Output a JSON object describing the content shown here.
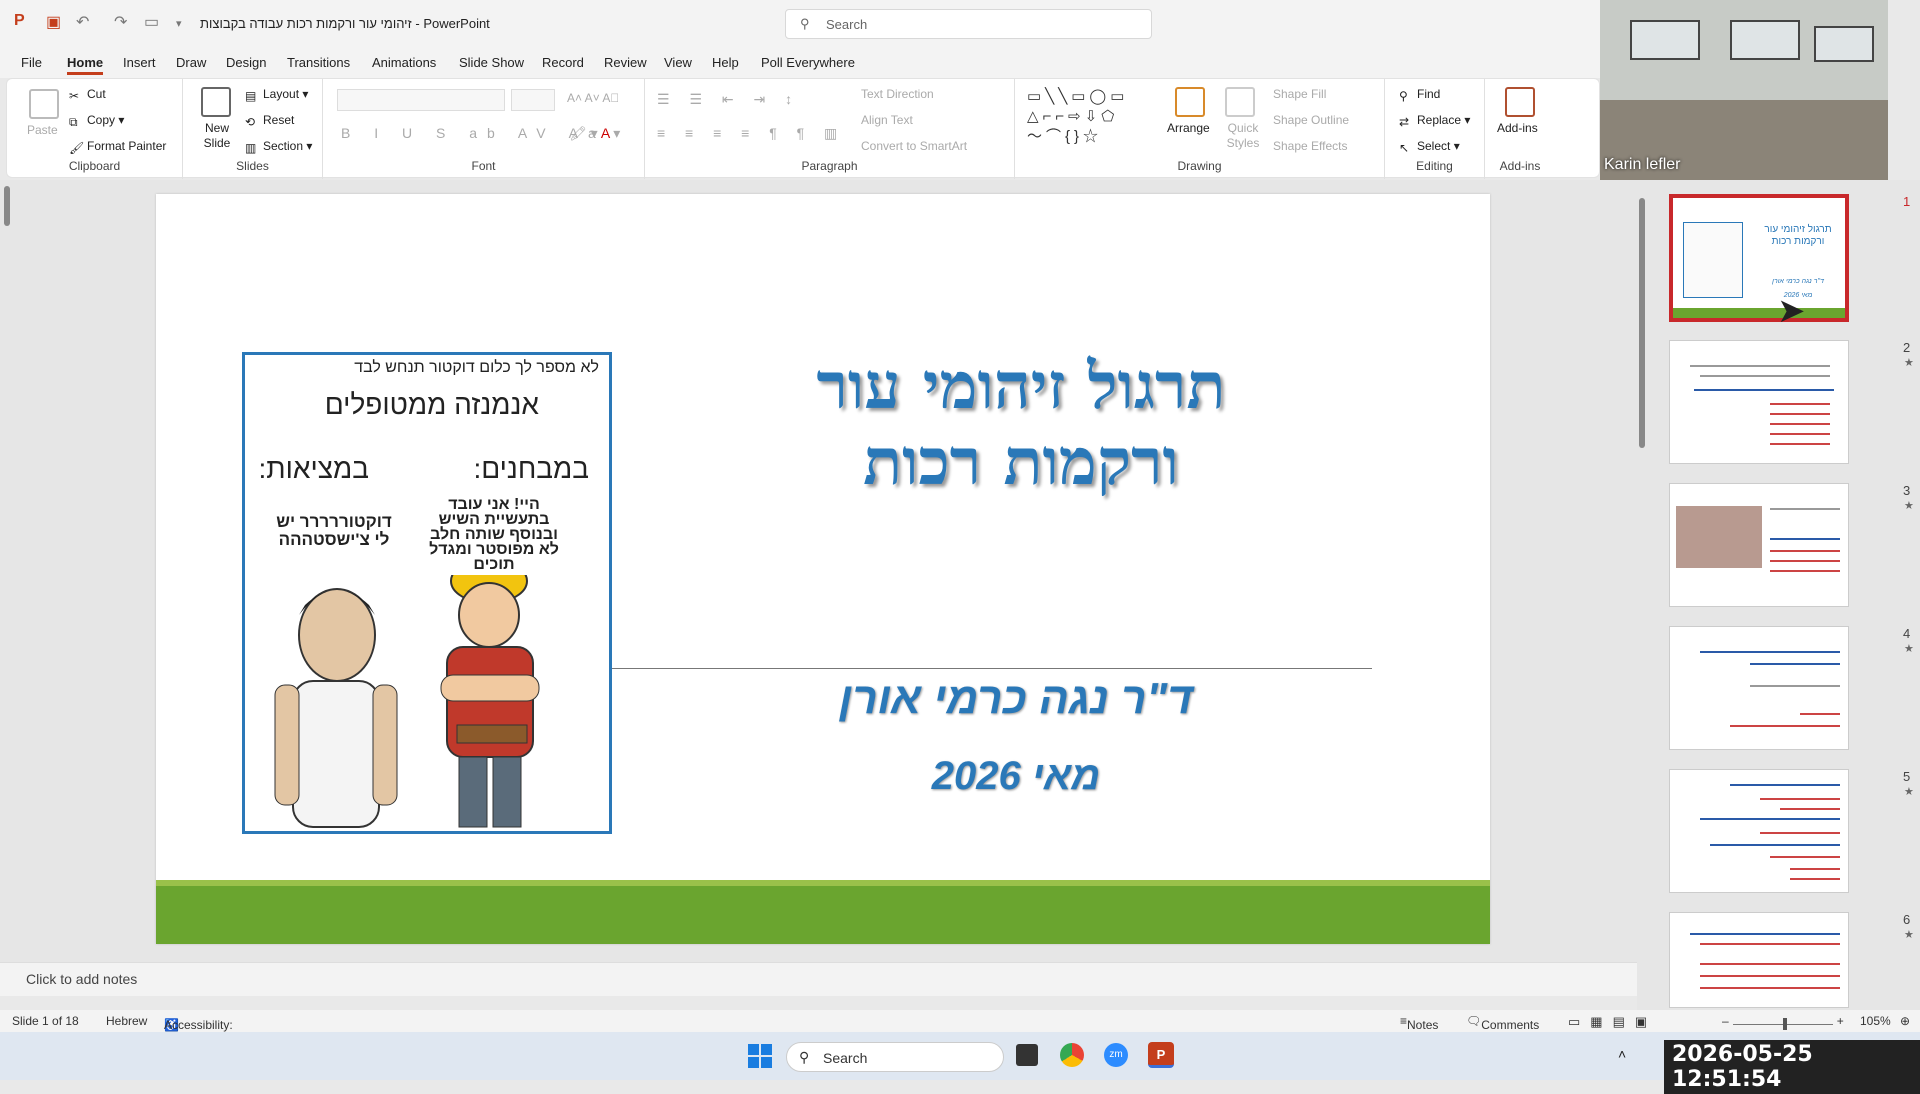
{
  "window": {
    "title": "זיהומי עור ורקמות רכות עבודה בקבוצות  -  PowerPoint"
  },
  "search": {
    "placeholder": "Search"
  },
  "menu": [
    "File",
    "Home",
    "Insert",
    "Draw",
    "Design",
    "Transitions",
    "Animations",
    "Slide Show",
    "Record",
    "Review",
    "View",
    "Help",
    "Poll Everywhere"
  ],
  "ribbon": {
    "clipboard": {
      "paste": "Paste",
      "cut": "Cut",
      "copy": "Copy",
      "format_painter": "Format Painter",
      "label": "Clipboard"
    },
    "slides": {
      "new_slide": "New Slide",
      "layout": "Layout",
      "reset": "Reset",
      "section": "Section",
      "label": "Slides"
    },
    "font": {
      "label": "Font"
    },
    "paragraph": {
      "text_direction": "Text Direction",
      "align_text": "Align Text",
      "convert_smartart": "Convert to SmartArt",
      "label": "Paragraph"
    },
    "drawing": {
      "arrange": "Arrange",
      "quick_styles": "Quick Styles",
      "shape_fill": "Shape Fill",
      "shape_outline": "Shape Outline",
      "shape_effects": "Shape Effects",
      "label": "Drawing"
    },
    "editing": {
      "find": "Find",
      "replace": "Replace",
      "select": "Select",
      "label": "Editing"
    },
    "addins": {
      "addins": "Add-ins",
      "label": "Add-ins"
    }
  },
  "video": {
    "participant": "Karin lefler"
  },
  "slide": {
    "title_line1": "תרגול זיהומי עור",
    "title_line2": "ורקמות רכות",
    "author": "ד\"ר נגה כרמי אורן",
    "date": "מאי 2026",
    "picture": {
      "top_caption": "לא מספר לך כלום דוקטור תנחש לבד",
      "heading": "אנמנזה ממטופלים",
      "in_exams": "במבחנים:",
      "in_reality": "במציאות:",
      "worker_quote": "היי! אני עובד בתעשיית השיש ובנוסף שותה חלב לא מפוסטר ומגדל תוכים",
      "man_quote": "דוקטוררררר יש לי צ'ישסטההה"
    }
  },
  "notes": {
    "placeholder": "Click to add notes"
  },
  "thumbnails": [
    {
      "num": "1",
      "star": ""
    },
    {
      "num": "2",
      "star": "★"
    },
    {
      "num": "3",
      "star": "★"
    },
    {
      "num": "4",
      "star": "★"
    },
    {
      "num": "5",
      "star": "★"
    },
    {
      "num": "6",
      "star": "★"
    }
  ],
  "thumb1": {
    "title": "תרגול זיהומי עור ורקמות רכות",
    "author": "ד\"ר נגה כרמי אורן",
    "date": "מאי 2026"
  },
  "status": {
    "slide": "Slide 1 of 18",
    "language": "Hebrew",
    "accessibility": "Accessibility: Investigate",
    "notes": "Notes",
    "comments": "Comments",
    "zoom": "105%"
  },
  "taskbar": {
    "search": "Search",
    "clock": "2026-05-25 12:51:54"
  }
}
